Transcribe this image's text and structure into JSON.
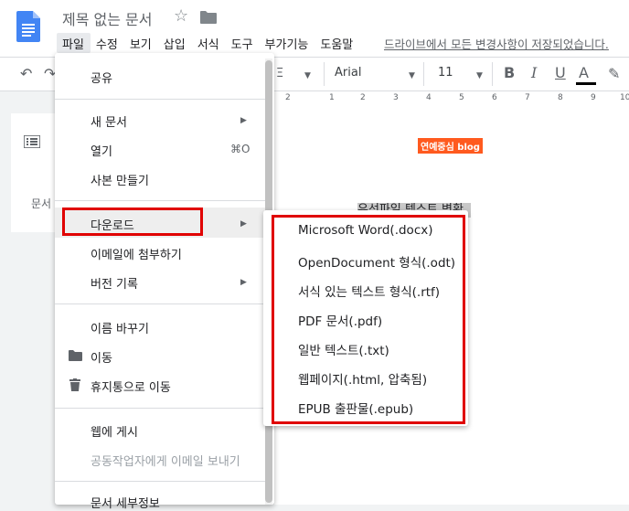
{
  "header": {
    "title": "제목 없는 문서",
    "menus": [
      "파일",
      "수정",
      "보기",
      "삽입",
      "서식",
      "도구",
      "부가기능",
      "도움말"
    ],
    "saved_status": "드라이브에서 모든 변경사항이 저장되었습니다."
  },
  "toolbar": {
    "font": "Arial",
    "font_size": "11",
    "bold": "B",
    "italic": "I",
    "underline": "U",
    "text_color": "A"
  },
  "ruler": {
    "marks": [
      "2",
      "1",
      "2",
      "3",
      "4",
      "5",
      "6",
      "7",
      "8",
      "9",
      "10"
    ]
  },
  "outline": {
    "label": "문서"
  },
  "document": {
    "badge": "연예중심 blog",
    "highlight": "유선파일 텍스트 변환"
  },
  "file_menu": {
    "share": "공유",
    "new_doc": "새 문서",
    "open": "열기",
    "open_shortcut": "⌘O",
    "copy": "사본 만들기",
    "download": "다운로드",
    "email_attach": "이메일에 첨부하기",
    "version_history": "버전 기록",
    "rename": "이름 바꾸기",
    "move": "이동",
    "trash": "휴지통으로 이동",
    "publish": "웹에 게시",
    "email_collab": "공동작업자에게 이메일 보내기",
    "doc_details": "문서 세부정보"
  },
  "download_menu": {
    "items": [
      "Microsoft Word(.docx)",
      "OpenDocument 형식(.odt)",
      "서식 있는 텍스트 형식(.rtf)",
      "PDF 문서(.pdf)",
      "일반 텍스트(.txt)",
      "웹페이지(.html, 압축됨)",
      "EPUB 출판물(.epub)"
    ]
  },
  "colors": {
    "highlight_box": "#e00000",
    "badge_bg": "#ff5a1f",
    "docs_blue": "#4285f4"
  }
}
